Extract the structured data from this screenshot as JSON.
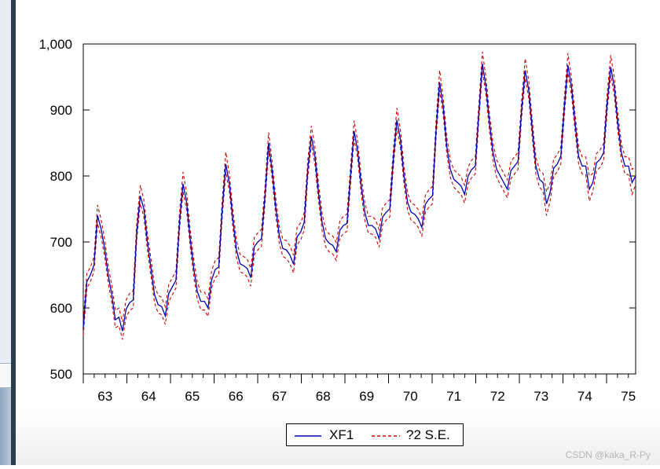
{
  "chart_data": {
    "type": "line",
    "y_ticks": [
      "500",
      "600",
      "700",
      "800",
      "900",
      "1,000"
    ],
    "ylim": [
      500,
      1000
    ],
    "x_tick_labels": [
      "63",
      "64",
      "65",
      "66",
      "67",
      "68",
      "69",
      "70",
      "71",
      "72",
      "73",
      "74",
      "75"
    ],
    "x_start": 1963,
    "x_end": 1975.6667,
    "series": [
      {
        "name": "XF1",
        "color": "#0000b0",
        "style": "solid",
        "values": [
          570,
          640,
          650,
          665,
          740,
          720,
          690,
          650,
          620,
          582,
          586,
          565,
          598,
          608,
          612,
          715,
          770,
          750,
          700,
          660,
          620,
          605,
          602,
          588,
          622,
          632,
          642,
          730,
          788,
          760,
          705,
          660,
          625,
          610,
          610,
          600,
          642,
          658,
          662,
          750,
          818,
          788,
          733,
          688,
          667,
          664,
          660,
          646,
          693,
          700,
          705,
          770,
          850,
          808,
          753,
          710,
          690,
          688,
          680,
          666,
          708,
          715,
          730,
          810,
          860,
          830,
          775,
          730,
          705,
          698,
          695,
          685,
          718,
          725,
          728,
          800,
          868,
          838,
          785,
          745,
          725,
          725,
          720,
          705,
          738,
          745,
          750,
          825,
          885,
          855,
          800,
          760,
          745,
          742,
          735,
          722,
          757,
          765,
          770,
          870,
          942,
          905,
          845,
          810,
          795,
          790,
          785,
          772,
          800,
          810,
          815,
          895,
          970,
          935,
          880,
          835,
          810,
          800,
          790,
          780,
          808,
          815,
          822,
          900,
          960,
          930,
          870,
          815,
          795,
          790,
          758,
          775,
          812,
          818,
          830,
          905,
          968,
          935,
          880,
          830,
          815,
          815,
          780,
          790,
          820,
          825,
          835,
          910,
          965,
          935,
          880,
          835,
          815,
          815,
          790,
          800
        ]
      },
      {
        "name": "?2 S.E.",
        "color": "#cc0000",
        "style": "dashed",
        "values": [
          [
            558,
            630,
            640,
            655,
            728,
            708,
            678,
            638,
            608,
            570,
            573,
            552,
            586,
            596,
            600,
            703,
            758,
            738,
            688,
            648,
            608,
            592,
            590,
            575,
            610,
            620,
            630,
            718,
            776,
            748,
            693,
            648,
            613,
            597,
            597,
            587,
            630,
            646,
            650,
            738,
            806,
            776,
            721,
            676,
            655,
            652,
            647,
            633,
            681,
            688,
            693,
            758,
            838,
            796,
            741,
            698,
            678,
            675,
            667,
            653,
            696,
            703,
            718,
            798,
            848,
            818,
            763,
            718,
            693,
            685,
            682,
            672,
            706,
            713,
            716,
            788,
            856,
            826,
            773,
            733,
            713,
            712,
            707,
            692,
            726,
            733,
            738,
            813,
            873,
            843,
            788,
            748,
            733,
            729,
            722,
            709,
            745,
            753,
            758,
            858,
            930,
            893,
            833,
            798,
            783,
            777,
            772,
            759,
            788,
            798,
            803,
            883,
            958,
            923,
            868,
            823,
            798,
            787,
            777,
            767,
            796,
            803,
            810,
            888,
            948,
            918,
            858,
            803,
            783,
            777,
            740,
            762,
            800,
            806,
            818,
            893,
            956,
            923,
            868,
            818,
            803,
            802,
            762,
            777,
            808,
            813,
            823,
            898,
            953,
            923,
            868,
            823,
            803,
            802,
            772,
            787
          ],
          [
            582,
            652,
            662,
            677,
            756,
            734,
            704,
            664,
            634,
            596,
            600,
            579,
            612,
            622,
            626,
            729,
            786,
            764,
            714,
            674,
            634,
            619,
            616,
            602,
            636,
            646,
            656,
            744,
            806,
            774,
            719,
            674,
            639,
            624,
            624,
            614,
            656,
            672,
            676,
            764,
            836,
            802,
            747,
            702,
            681,
            678,
            674,
            660,
            707,
            714,
            719,
            784,
            866,
            822,
            767,
            724,
            704,
            702,
            694,
            680,
            722,
            729,
            744,
            824,
            876,
            844,
            789,
            744,
            719,
            712,
            709,
            699,
            732,
            739,
            742,
            814,
            884,
            852,
            799,
            759,
            739,
            739,
            734,
            719,
            752,
            759,
            764,
            839,
            903,
            869,
            814,
            774,
            759,
            756,
            749,
            736,
            771,
            779,
            784,
            884,
            960,
            919,
            859,
            824,
            809,
            804,
            799,
            786,
            814,
            824,
            829,
            909,
            988,
            949,
            894,
            849,
            824,
            814,
            804,
            794,
            822,
            829,
            836,
            914,
            978,
            944,
            884,
            829,
            809,
            804,
            776,
            789,
            826,
            832,
            844,
            919,
            986,
            949,
            894,
            844,
            829,
            829,
            800,
            804,
            834,
            839,
            849,
            924,
            983,
            949,
            894,
            849,
            829,
            829,
            810,
            814
          ]
        ]
      }
    ],
    "legend": {
      "position": "bottom-center",
      "entries": [
        "XF1",
        "?2 S.E."
      ]
    },
    "grid": false
  },
  "watermark": "CSDN @kaka_R-Py"
}
